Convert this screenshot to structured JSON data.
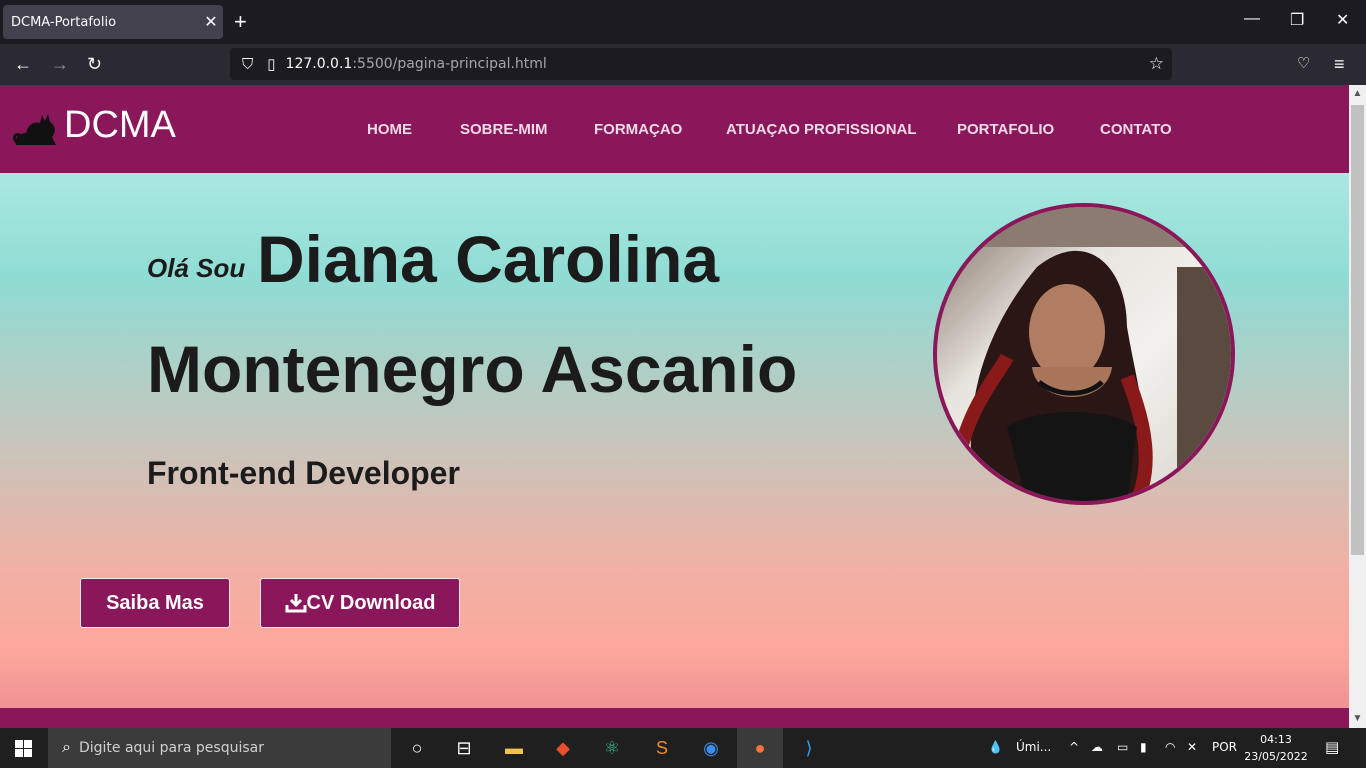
{
  "browser": {
    "tab_title": "DCMA-Portafolio",
    "url_host": "127.0.0.1",
    "url_rest": ":5500/pagina-principal.html"
  },
  "site": {
    "logo": "DCMA",
    "menu": [
      "HOME",
      "SOBRE-MIM",
      "FORMAÇAO",
      "ATUAÇAO PROFISSIONAL",
      "PORTAFOLIO",
      "CONTATO"
    ],
    "greeting": "Olá Sou",
    "name_line1": "Diana Carolina",
    "name_line2": "Montenegro Ascanio",
    "role": "Front-end Developer",
    "btn_more": "Saiba Mas",
    "btn_cv": "CV Download"
  },
  "taskbar": {
    "search_placeholder": "Digite aqui para pesquisar",
    "weather": "Úmi...",
    "lang": "POR",
    "time": "04:13",
    "date": "23/05/2022"
  },
  "colors": {
    "brand": "#8a1759",
    "text": "#1b1b1b"
  }
}
